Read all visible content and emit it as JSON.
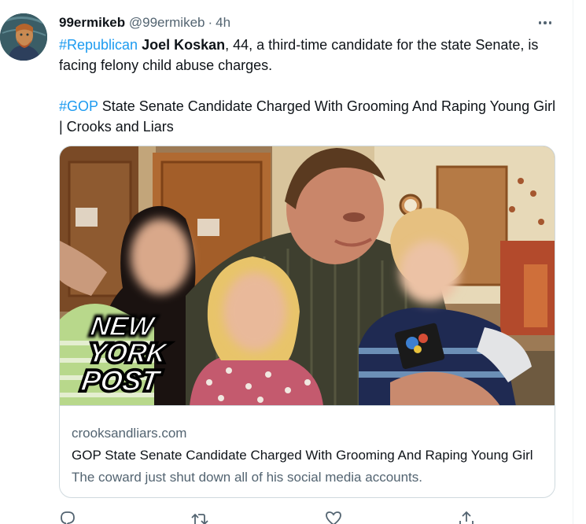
{
  "tweet": {
    "author": {
      "display_name": "99ermikeb",
      "handle": "@99ermikeb",
      "separator": "·",
      "time": "4h",
      "avatar_icon": "van-gogh-portrait-avatar"
    },
    "text": {
      "line1_hashtag": "#Republican",
      "line1_bold": "Joel Koskan",
      "line1_rest": ", 44, a third-time candidate for the state Senate, is facing felony child abuse charges.",
      "line2_hashtag": "#GOP",
      "line2_rest": " State Senate Candidate Charged With Grooming And Raping Young Girl | Crooks and Liars"
    },
    "card": {
      "image_watermark": [
        "NEW",
        "YORK",
        "POST"
      ],
      "domain": "crooksandliars.com",
      "title": "GOP State Senate Candidate Charged With Grooming And Raping Young Girl",
      "description": "The coward just shut down all of his social media accounts."
    },
    "actions": [
      "reply-icon",
      "retweet-icon",
      "like-icon",
      "share-icon"
    ]
  },
  "colors": {
    "link": "#1d9bf0",
    "text": "#0f1419",
    "secondary": "#536471",
    "border": "#cfd9de"
  }
}
